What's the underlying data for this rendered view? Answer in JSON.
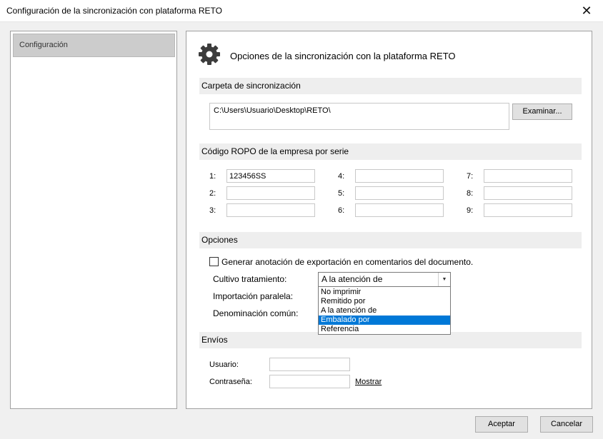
{
  "window": {
    "title": "Configuración de la sincronización con plataforma RETO",
    "close_glyph": "✕"
  },
  "sidebar": {
    "items": [
      {
        "label": "Configuración"
      }
    ]
  },
  "header": {
    "icon": "gear-icon",
    "title": "Opciones de la sincronización con la plataforma RETO"
  },
  "folder": {
    "section_title": "Carpeta de sincronización",
    "path": "C:\\Users\\Usuario\\Desktop\\RETO\\",
    "browse_label": "Examinar..."
  },
  "ropo": {
    "section_title": "Código ROPO de la empresa por serie",
    "fields": [
      {
        "label": "1:",
        "value": "123456SS"
      },
      {
        "label": "2:",
        "value": ""
      },
      {
        "label": "3:",
        "value": ""
      },
      {
        "label": "4:",
        "value": ""
      },
      {
        "label": "5:",
        "value": ""
      },
      {
        "label": "6:",
        "value": ""
      },
      {
        "label": "7:",
        "value": ""
      },
      {
        "label": "8:",
        "value": ""
      },
      {
        "label": "9:",
        "value": ""
      }
    ]
  },
  "opciones": {
    "section_title": "Opciones",
    "checkbox_label": "Generar anotación de exportación en comentarios del documento.",
    "checkbox_checked": false,
    "cultivo_label": "Cultivo tratamiento:",
    "cultivo_value": "A la atención de",
    "importacion_label": "Importación paralela:",
    "denominacion_label": "Denominación común:",
    "dropdown_options": [
      "No imprimir",
      "Remitido por",
      "A la atención de",
      "Embalado por",
      "Referencia"
    ],
    "highlighted_option": "Embalado por"
  },
  "envios": {
    "section_title": "Envíos",
    "usuario_label": "Usuario:",
    "usuario_value": "",
    "password_label": "Contraseña:",
    "password_value": "",
    "show_link": "Mostrar"
  },
  "footer": {
    "accept_label": "Aceptar",
    "cancel_label": "Cancelar"
  },
  "colors": {
    "selection": "#0078d7",
    "section_bg": "#eeeeee",
    "sidebar_selected": "#cccccc"
  }
}
